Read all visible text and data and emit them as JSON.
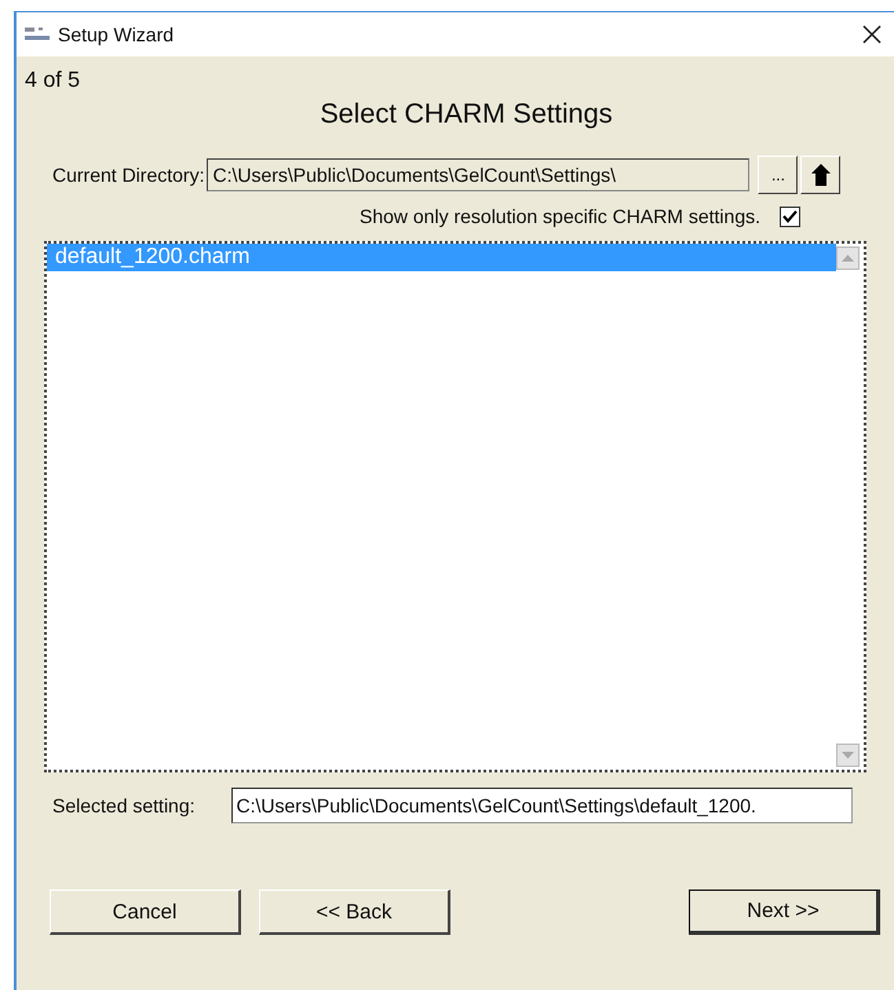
{
  "window": {
    "title": "Setup Wizard"
  },
  "step": "4 of 5",
  "heading": "Select CHARM Settings",
  "directory": {
    "label": "Current Directory:",
    "value": "C:\\Users\\Public\\Documents\\GelCount\\Settings\\",
    "browse_button": "..."
  },
  "filter": {
    "label": "Show only resolution specific CHARM settings.",
    "checked": true
  },
  "files": [
    {
      "name": "default_1200.charm",
      "selected": true
    }
  ],
  "selected_setting": {
    "label": "Selected setting:",
    "value": "C:\\Users\\Public\\Documents\\GelCount\\Settings\\default_1200."
  },
  "buttons": [
    {
      "label": "Cancel",
      "kind": "cancel"
    },
    {
      "label": "<< Back",
      "kind": "back"
    },
    {
      "label": "Next >>",
      "kind": "next"
    }
  ]
}
